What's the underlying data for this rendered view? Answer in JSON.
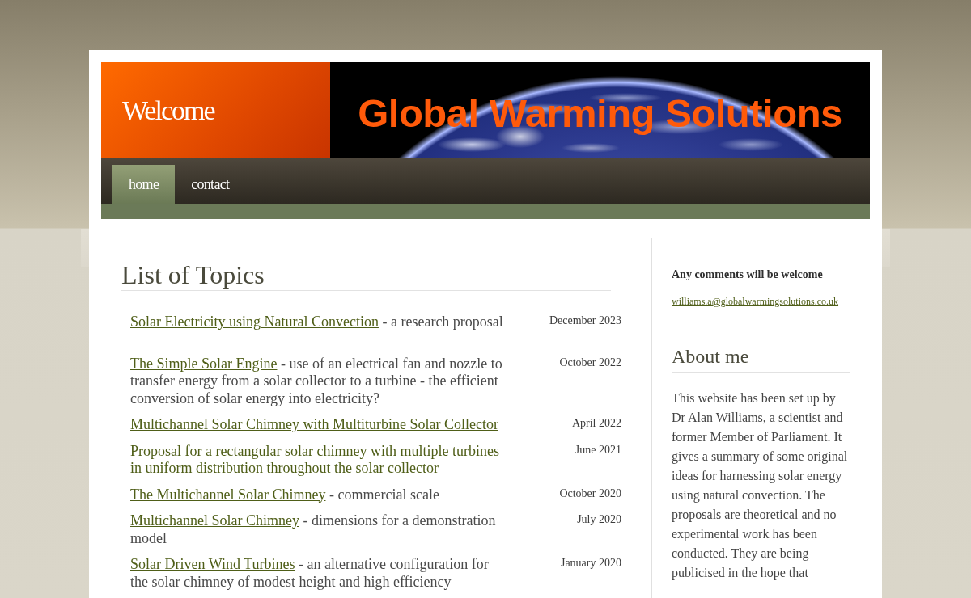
{
  "header": {
    "welcome": "Welcome",
    "title": "Global Warming Solutions"
  },
  "nav": [
    {
      "label": "home",
      "selected": true
    },
    {
      "label": "contact",
      "selected": false
    }
  ],
  "main": {
    "heading": "List of Topics",
    "topics": [
      {
        "link": "Solar Electricity using Natural Convection",
        "description": "- a research proposal",
        "date": "December 2023"
      },
      {
        "link": "The Simple Solar Engine",
        "description": "- use of an electrical fan and nozzle to transfer energy from a solar collector to a turbine - the efficient conversion of solar energy into electricity?",
        "date": "October 2022"
      },
      {
        "link": "Multichannel Solar Chimney with Multiturbine Solar Collector",
        "date": "April 2022"
      },
      {
        "link": "Proposal for a rectangular solar chimney with multiple turbines in uniform distribution throughout the solar collector",
        "date": "June 2021"
      },
      {
        "link": "The Multichannel Solar Chimney",
        "description": "- commercial scale",
        "date": "October 2020"
      },
      {
        "link": "Multichannel Solar Chimney",
        "description": "- dimensions for a demonstration model",
        "date": "July 2020"
      },
      {
        "link": "Solar Driven Wind Turbines",
        "description": "- an alternative configuration for the solar chimney of modest height and high efficiency",
        "date": "January 2020"
      }
    ]
  },
  "sidebar": {
    "comments": "Any comments will be welcome",
    "email": "williams.a@globalwarmingsolutions.co.uk",
    "about_heading": "About me",
    "about_text": "This website has been set up by Dr Alan Williams, a scientist and former Member of Parliament. It gives a summary of some original ideas for harnessing solar energy using natural convection. The proposals are theoretical and no experimental work has been conducted. They are being publicised in the hope that"
  }
}
